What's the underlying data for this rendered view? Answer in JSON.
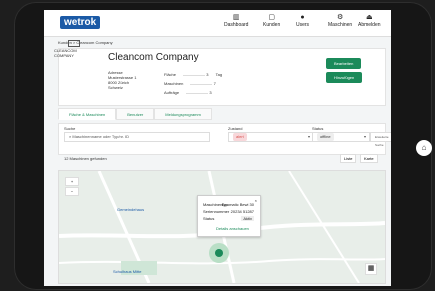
{
  "app": {
    "logo_text": "wetrok"
  },
  "nav": [
    {
      "label": "Dashboard",
      "icon": "chart-icon"
    },
    {
      "label": "Kunden",
      "icon": "clipboard-icon"
    },
    {
      "label": "Users",
      "icon": "user-icon"
    },
    {
      "label": "Maschinen",
      "icon": "machine-icon"
    },
    {
      "label": "Abmelden",
      "icon": "logout-icon"
    }
  ],
  "breadcrumb": "Kunden > Cleancom Company",
  "company": {
    "name": "Cleancom Company",
    "logo_text": "CLEANCOM COMPANY",
    "address_label": "Adresse",
    "address_lines": [
      "Musterstrasse 1",
      "8000 Zürich",
      "Schweiz"
    ],
    "facts": [
      {
        "label": "Fläche",
        "value": "3",
        "unit": "Tag"
      },
      {
        "label": "Maschinen",
        "value": "7",
        "unit": ""
      },
      {
        "label": "Aufträge",
        "value": "3",
        "unit": ""
      }
    ],
    "button_primary": "Bearbeiten",
    "button_secondary": "Hinzufügen"
  },
  "tabs": [
    "Fläche & Maschinen",
    "Benutzer",
    "Meldungsprogramm"
  ],
  "filters": {
    "search_label": "Suche",
    "search_placeholder": "Maschinenname oder Typ/nr. ID",
    "status_label": "Zustand",
    "status_value": "alert",
    "status2_label": "Status",
    "status2_value": "offline",
    "advanced_label": "Erweiterte Suche"
  },
  "map": {
    "results": "12 Maschinen gefunden",
    "view_list": "Liste",
    "view_map": "Karte",
    "zoom_in": "+",
    "zoom_out": "−",
    "popup": {
      "title_label": "Maschinentyp",
      "title_value": "Duomatic Bewi 30",
      "serial_label": "Seriennummer",
      "serial_value": "20234 51287",
      "status_label": "Status",
      "status_value": "Aktiv",
      "link": "Details anschauen"
    },
    "labels": [
      {
        "text": "Gemeindehaus"
      },
      {
        "text": "Schulhaus Mitte"
      }
    ]
  },
  "colors": {
    "brand": "#1b5aa6",
    "green": "#1b8a5a",
    "alert": "#d9534f"
  }
}
